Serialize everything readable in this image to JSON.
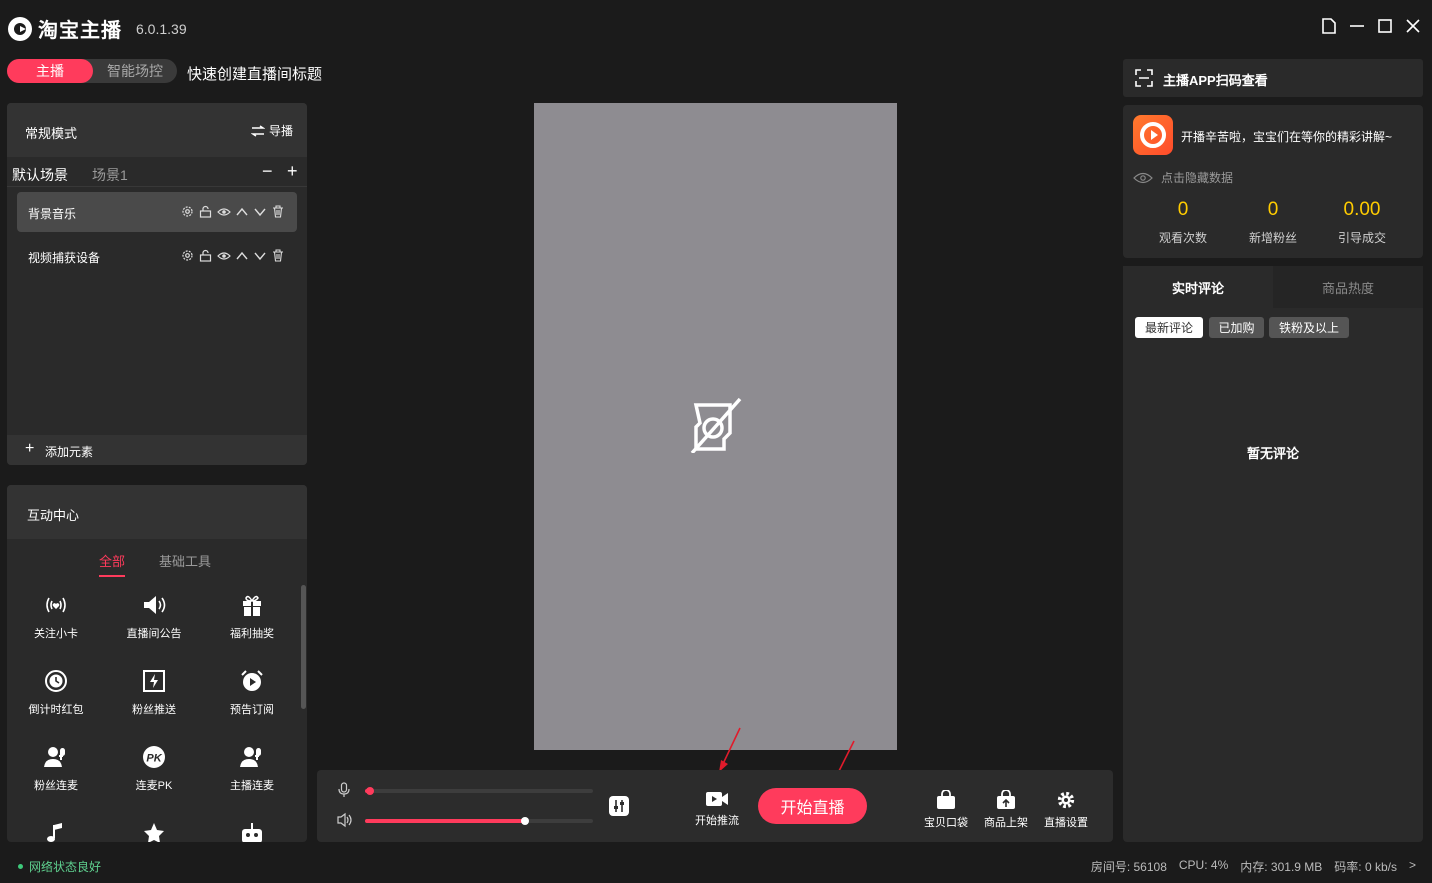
{
  "app": {
    "name": "淘宝主播",
    "version": "6.0.1.39"
  },
  "window_controls": [
    "restore-icon",
    "minimize-icon",
    "maximize-icon",
    "close-icon"
  ],
  "mode": {
    "active": "主播",
    "other": "智能场控"
  },
  "quick_title": "快速创建直播间标题",
  "scene_panel": {
    "title": "常规模式",
    "guide": "导播",
    "tabs": [
      "默认场景",
      "场景1"
    ],
    "elements": [
      {
        "label": "背景音乐",
        "selected": true
      },
      {
        "label": "视频捕获设备",
        "selected": false
      }
    ],
    "element_icons": [
      "gear-icon",
      "lock-icon",
      "eye-icon",
      "arrow-up-icon",
      "arrow-down-icon",
      "trash-icon"
    ],
    "add_label": "添加元素"
  },
  "hub": {
    "title": "互动中心",
    "tabs": [
      "全部",
      "基础工具"
    ],
    "tools": [
      {
        "label": "关注小卡",
        "icon": "broadcast-heart-icon"
      },
      {
        "label": "直播间公告",
        "icon": "speaker-icon"
      },
      {
        "label": "福利抽奖",
        "icon": "gift-icon"
      },
      {
        "label": "倒计时红包",
        "icon": "clock-icon"
      },
      {
        "label": "粉丝推送",
        "icon": "push-icon"
      },
      {
        "label": "预告订阅",
        "icon": "alarm-icon"
      },
      {
        "label": "粉丝连麦",
        "icon": "user-mic-icon"
      },
      {
        "label": "连麦PK",
        "icon": "pk-icon"
      },
      {
        "label": "主播连麦",
        "icon": "user-mic-icon"
      },
      {
        "label": "",
        "icon": "music-icon"
      },
      {
        "label": "",
        "icon": "star-icon"
      },
      {
        "label": "",
        "icon": "robot-icon"
      }
    ]
  },
  "preview": {
    "icon": "no-camera-icon"
  },
  "controls": {
    "mic_level": 0.02,
    "volume_level": 0.7,
    "push_label": "开始推流",
    "go_live": "开始直播",
    "right_buttons": [
      {
        "label": "宝贝口袋",
        "icon": "bag-icon"
      },
      {
        "label": "商品上架",
        "icon": "upload-bag-icon"
      },
      {
        "label": "直播设置",
        "icon": "gear-icon"
      }
    ]
  },
  "right": {
    "scan_label": "主播APP扫码查看",
    "greeting": "开播辛苦啦，宝宝们在等你的精彩讲解~",
    "hide_data": "点击隐藏数据",
    "stats": [
      {
        "value": "0",
        "label": "观看次数"
      },
      {
        "value": "0",
        "label": "新增粉丝"
      },
      {
        "value": "0.00",
        "label": "引导成交"
      }
    ],
    "comment_tabs": [
      "实时评论",
      "商品热度"
    ],
    "chips": [
      "最新评论",
      "已加购",
      "铁粉及以上"
    ],
    "empty": "暂无评论"
  },
  "status": {
    "network": "网络状态良好",
    "room": "房间号: 56108",
    "cpu": "CPU: 4%",
    "memory": "内存: 301.9 MB",
    "bitrate": "码率: 0 kb/s",
    "more": ">"
  },
  "colors": {
    "accent": "#ff3b5c",
    "stat": "#ffcc00",
    "network_ok": "#3dc97a"
  }
}
